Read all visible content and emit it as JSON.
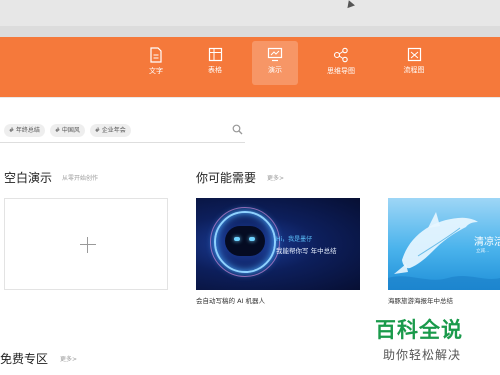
{
  "toolbar": {
    "items": [
      {
        "label": "文字",
        "icon": "document-icon"
      },
      {
        "label": "表格",
        "icon": "table-icon"
      },
      {
        "label": "演示",
        "icon": "presentation-icon",
        "active": true
      },
      {
        "label": "思维导图",
        "icon": "mindmap-icon"
      },
      {
        "label": "流程图",
        "icon": "flowchart-icon"
      }
    ],
    "accent": "#f5793b"
  },
  "search": {
    "tags": [
      "# 年终总结",
      "# 中国风",
      "# 企业年会"
    ]
  },
  "blank_section": {
    "title": "空白演示",
    "subtitle": "从零开始创作"
  },
  "suggest_section": {
    "title": "你可能需要",
    "more": "更多>",
    "cards": [
      {
        "caption": "会自动写稿的 AI 机器人",
        "line1": "Hi，我是墨仔",
        "line2": "我能帮你写 年中总结"
      },
      {
        "caption": "海豚旅游海报年中总结",
        "title": "清凉活",
        "sub": "立减..."
      }
    ]
  },
  "free_section": {
    "title": "免费专区",
    "more": "更多>"
  },
  "watermark": {
    "title": "百科全说",
    "subtitle": "助你轻松解决"
  }
}
